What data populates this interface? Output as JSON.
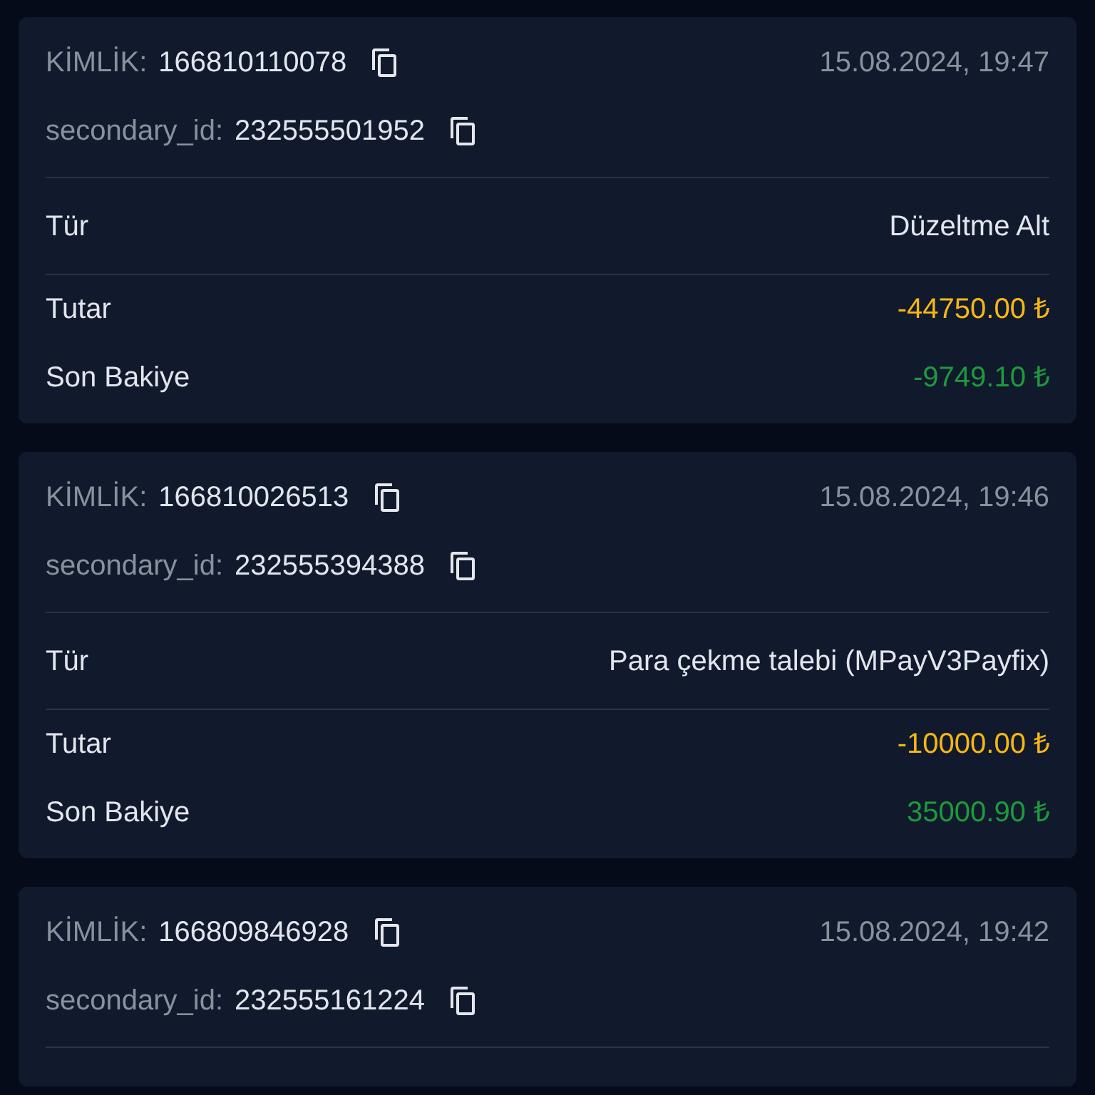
{
  "transactions": [
    {
      "id_label": "KİMLİK:",
      "id": "166810110078",
      "datetime": "15.08.2024, 19:47",
      "secondary_label": "secondary_id:",
      "secondary_id": "232555501952",
      "rows": [
        {
          "kind": "type",
          "label": "Tür",
          "value": "Düzeltme Alt"
        },
        {
          "kind": "amount",
          "label": "Tutar",
          "value": "-44750.00 ₺"
        },
        {
          "kind": "balance",
          "label": "Son Bakiye",
          "value": "-9749.10 ₺"
        }
      ]
    },
    {
      "id_label": "KİMLİK:",
      "id": "166810026513",
      "datetime": "15.08.2024, 19:46",
      "secondary_label": "secondary_id:",
      "secondary_id": "232555394388",
      "rows": [
        {
          "kind": "type",
          "label": "Tür",
          "value": "Para çekme talebi (MPayV3Payfix)"
        },
        {
          "kind": "amount",
          "label": "Tutar",
          "value": "-10000.00 ₺"
        },
        {
          "kind": "balance",
          "label": "Son Bakiye",
          "value": "35000.90 ₺"
        }
      ]
    },
    {
      "id_label": "KİMLİK:",
      "id": "166809846928",
      "datetime": "15.08.2024, 19:42",
      "secondary_label": "secondary_id:",
      "secondary_id": "232555161224"
    }
  ]
}
